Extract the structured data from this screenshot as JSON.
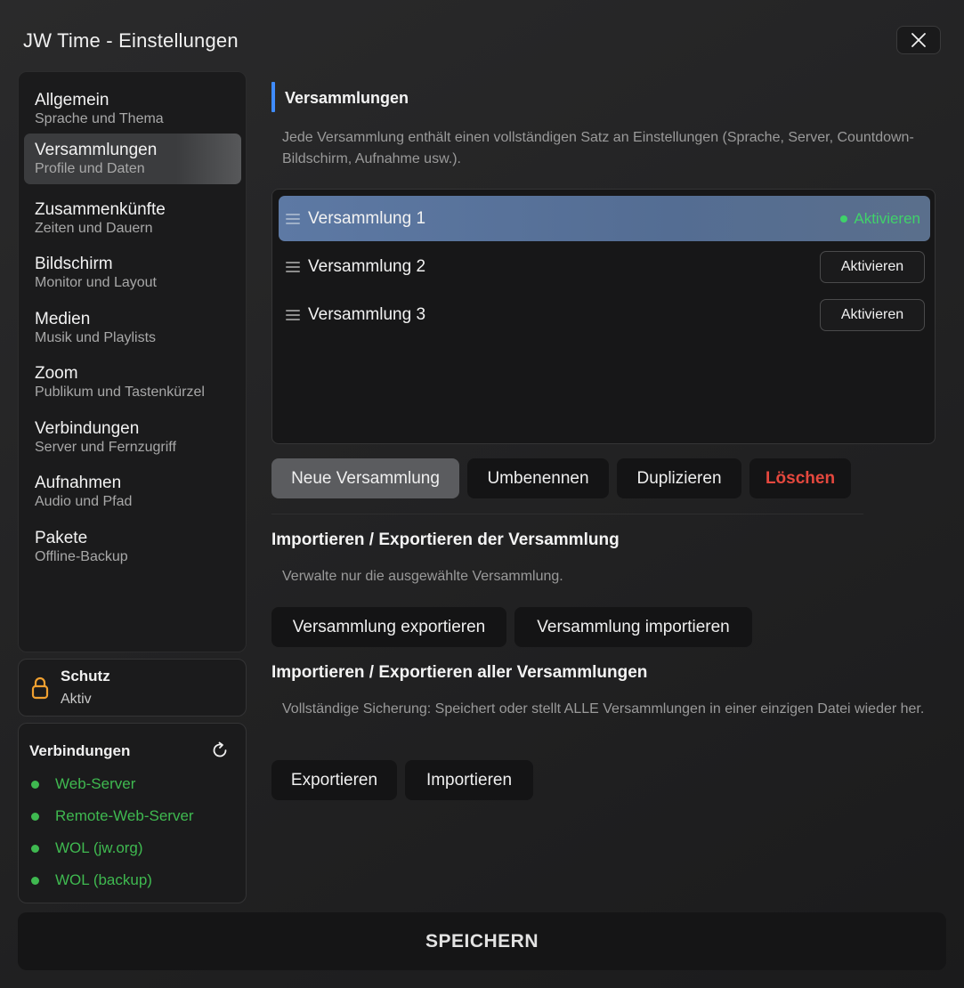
{
  "window": {
    "title": "JW Time - Einstellungen"
  },
  "sidebar": {
    "items": [
      {
        "label": "Allgemein",
        "sub": "Sprache und Thema"
      },
      {
        "label": "Versammlungen",
        "sub": "Profile und Daten",
        "active": true
      },
      {
        "label": "Zusammenkünfte",
        "sub": "Zeiten und Dauern"
      },
      {
        "label": "Bildschirm",
        "sub": "Monitor und Layout"
      },
      {
        "label": "Medien",
        "sub": "Musik und Playlists"
      },
      {
        "label": "Zoom",
        "sub": "Publikum und Tastenkürzel"
      },
      {
        "label": "Verbindungen",
        "sub": "Server und Fernzugriff"
      },
      {
        "label": "Aufnahmen",
        "sub": "Audio und Pfad"
      },
      {
        "label": "Pakete",
        "sub": "Offline-Backup"
      }
    ],
    "protection": {
      "title": "Schutz",
      "status": "Aktiv"
    },
    "connections": {
      "title": "Verbindungen",
      "status_color": "#3fb950",
      "items": [
        "Web-Server",
        "Remote-Web-Server",
        "WOL (jw.org)",
        "WOL (backup)"
      ]
    }
  },
  "main": {
    "section_title": "Versammlungen",
    "description": "Jede Versammlung enthält einen vollständigen Satz an Einstellungen (Sprache, Server, Countdown-Bildschirm, Aufnahme usw.).",
    "congregations": [
      {
        "name": "Versammlung 1",
        "active": true,
        "status": "Aktivieren"
      },
      {
        "name": "Versammlung 2",
        "active": false,
        "button": "Aktivieren"
      },
      {
        "name": "Versammlung 3",
        "active": false,
        "button": "Aktivieren"
      }
    ],
    "actions": {
      "new": "Neue Versammlung",
      "rename": "Umbenennen",
      "duplicate": "Duplizieren",
      "delete": "Löschen"
    },
    "single_io": {
      "title": "Importieren / Exportieren der Versammlung",
      "description": "Verwalte nur die ausgewählte Versammlung.",
      "export": "Versammlung exportieren",
      "import": "Versammlung importieren"
    },
    "all_io": {
      "title": "Importieren / Exportieren aller Versammlungen",
      "description": "Vollständige Sicherung: Speichert oder stellt ALLE Versammlungen in einer einzigen Datei wieder her.",
      "export": "Exportieren",
      "import": "Importieren"
    }
  },
  "footer": {
    "save_label": "SPEICHERN"
  },
  "colors": {
    "accent": "#3f8cff",
    "active_row": "#5d79a4",
    "success": "#3fb950",
    "danger": "#e5483e"
  }
}
